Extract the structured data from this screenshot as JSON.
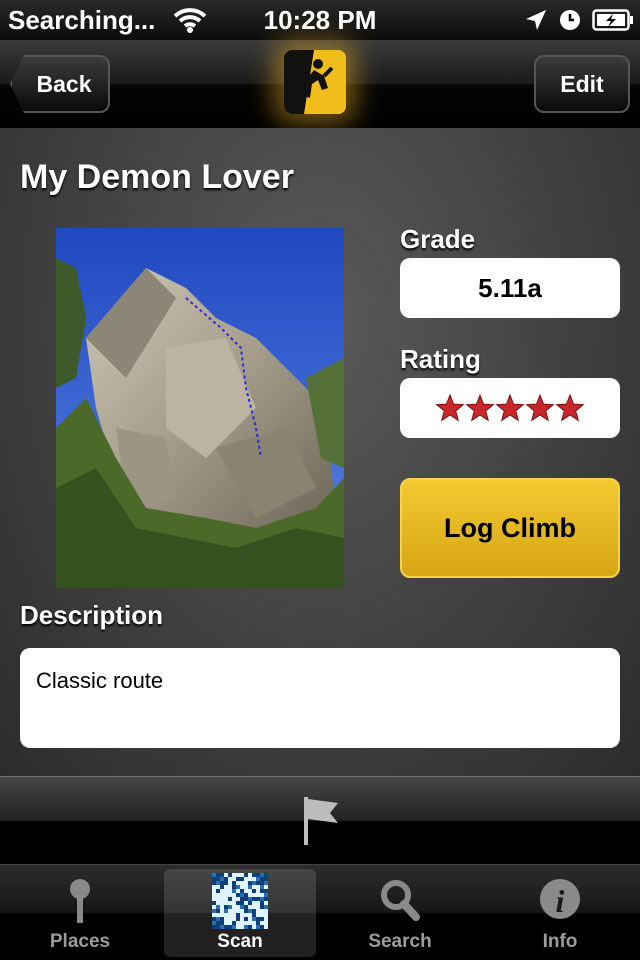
{
  "status_bar": {
    "carrier": "Searching...",
    "time": "10:28 PM"
  },
  "nav": {
    "back_label": "Back",
    "edit_label": "Edit",
    "logo_icon": "climber-logo-icon"
  },
  "route": {
    "title": "My Demon Lover",
    "grade_label": "Grade",
    "grade": "5.11a",
    "rating_label": "Rating",
    "rating_stars": 5,
    "rating_max": 5,
    "log_button_label": "Log Climb",
    "description_label": "Description",
    "description": "Classic route"
  },
  "tabs": [
    {
      "label": "Places",
      "icon": "pin-icon",
      "selected": false
    },
    {
      "label": "Scan",
      "icon": "qr-code-icon",
      "selected": true
    },
    {
      "label": "Search",
      "icon": "search-icon",
      "selected": false
    },
    {
      "label": "Info",
      "icon": "info-icon",
      "selected": false
    }
  ],
  "colors": {
    "accent_gold": "#f0bd1a",
    "star_red": "#c8262a"
  }
}
